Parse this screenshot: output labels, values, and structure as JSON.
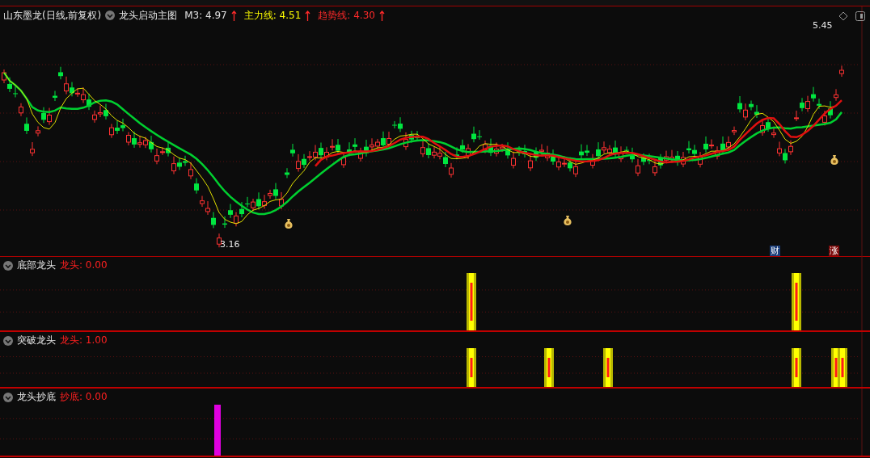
{
  "header": {
    "stock": "山东墨龙(日线,前复权)",
    "indicator": "龙头启动主图",
    "lines": [
      {
        "label": "M3:",
        "value": "4.97",
        "color": "#e0e0e0"
      },
      {
        "label": "主力线:",
        "value": "4.51",
        "color": "#ffff00"
      },
      {
        "label": "趋势线:",
        "value": "4.30",
        "color": "#ff2a2a"
      }
    ]
  },
  "price_labels": {
    "high": "5.45",
    "low": "3.16"
  },
  "markers": [
    {
      "text": "财",
      "kind": "finance"
    },
    {
      "text": "涨",
      "kind": "rise"
    }
  ],
  "panels": [
    {
      "title": "底部龙头",
      "series": "龙头",
      "value": ": 0.00"
    },
    {
      "title": "突破龙头",
      "series": "龙头",
      "value": ": 1.00"
    },
    {
      "title": "龙头抄底",
      "series": "抄底",
      "value": ": 0.00"
    }
  ]
}
